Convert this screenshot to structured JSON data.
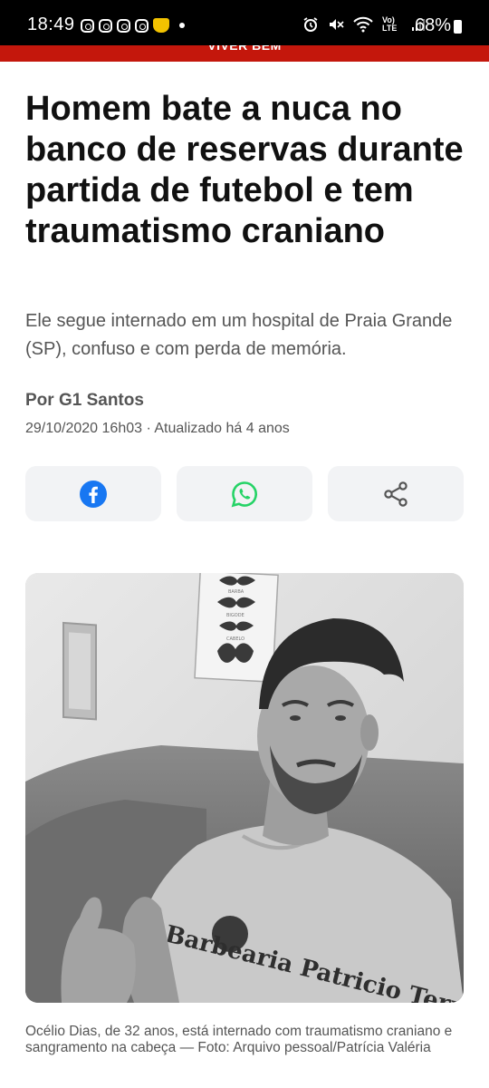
{
  "status_bar": {
    "time": "18:49",
    "battery": "68%",
    "network": "Vo) LTE"
  },
  "section": {
    "label": "VIVER BEM"
  },
  "article": {
    "title": "Homem bate a nuca no banco de reservas durante partida de futebol e tem traumatismo craniano",
    "subtitle": "Ele segue internado em um hospital de Praia Grande (SP), confuso e com perda de memória.",
    "author": "Por G1 Santos",
    "date": "29/10/2020 16h03 · Atualizado há 4 anos"
  },
  "share": {
    "buttons": [
      {
        "icon": "facebook-icon",
        "color": "#1877f2"
      },
      {
        "icon": "whatsapp-icon",
        "color": "#25d366"
      },
      {
        "icon": "share-icon",
        "color": "#555555"
      }
    ]
  },
  "photo": {
    "poster_lines": [
      "BARBA",
      "BIGODE",
      "CABELO"
    ],
    "shirt_text": "Barbearia Patricio Terra",
    "caption": "Océlio Dias, de 32 anos, está internado com traumatismo craniano e sangramento na cabeça — Foto: Arquivo pessoal/Patrícia Valéria"
  },
  "colors": {
    "brand_red": "#c4170c",
    "text_dark": "#111111",
    "text_muted": "#555555",
    "button_bg": "#f2f3f5"
  }
}
